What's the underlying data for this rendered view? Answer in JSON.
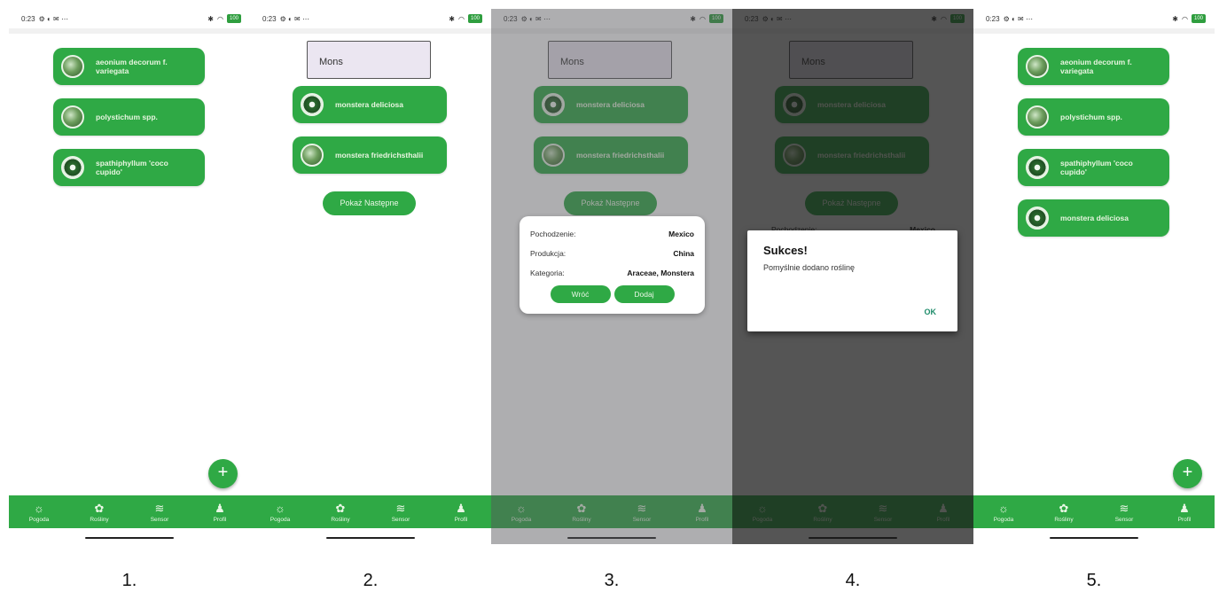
{
  "status": {
    "time": "0:23",
    "left_icons": "⚙ ◐ ✉ ⋯",
    "battery": "100"
  },
  "nav": [
    {
      "label": "Pogoda",
      "icon": "sun-icon",
      "glyph": "☼"
    },
    {
      "label": "Rośliny",
      "icon": "plant-icon",
      "glyph": "✿"
    },
    {
      "label": "Sensor",
      "icon": "wifi-icon",
      "glyph": "≋"
    },
    {
      "label": "Profil",
      "icon": "user-icon",
      "glyph": "♟"
    }
  ],
  "screen1": {
    "plants": [
      "aeonium decorum f. variegata",
      "polystichum spp.",
      "spathiphyllum 'coco cupido'"
    ],
    "fab": "+"
  },
  "screen2": {
    "search_value": "Mons",
    "results": [
      "monstera deliciosa",
      "monstera friedrichsthalii"
    ],
    "show_more": "Pokaż Następne"
  },
  "screen3": {
    "details": [
      {
        "key": "Pochodzenie:",
        "value": "Mexico"
      },
      {
        "key": "Produkcja:",
        "value": "China"
      },
      {
        "key": "Kategoria:",
        "value": "Araceae, Monstera"
      }
    ],
    "back": "Wróć",
    "add": "Dodaj",
    "partial_key": "Pochodzenie:",
    "partial_value": "Mexico"
  },
  "screen4": {
    "alert_title": "Sukces!",
    "alert_message": "Pomyślnie dodano roślinę",
    "alert_ok": "OK"
  },
  "screen5": {
    "plants": [
      "aeonium decorum f. variegata",
      "polystichum spp.",
      "spathiphyllum 'coco cupido'",
      "monstera deliciosa"
    ],
    "fab": "+"
  },
  "step_labels": [
    "1.",
    "2.",
    "3.",
    "4.",
    "5."
  ],
  "colors": {
    "accent": "#2fa945",
    "ok": "#1f8c6a"
  }
}
